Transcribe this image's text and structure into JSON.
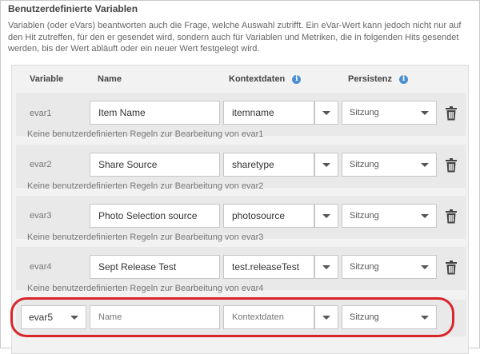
{
  "section": {
    "title": "Benutzerdefinierte Variablen",
    "description": "Variablen (oder eVars) beantworten auch die Frage, welche Auswahl zutrifft. Ein eVar-Wert kann jedoch nicht nur auf den Hit zutreffen, für den er gesendet wird, sondern auch für Variablen und Metriken, die in folgenden Hits gesendet werden, bis der Wert abläuft oder ein neuer Wert festgelegt wird."
  },
  "headers": {
    "variable": "Variable",
    "name": "Name",
    "context": "Kontextdaten",
    "persistence": "Persistenz",
    "info_glyph": "i"
  },
  "rows": [
    {
      "var": "evar1",
      "name": "Item Name",
      "context": "itemname",
      "persistence": "Sitzung",
      "note": "Keine benutzerdefinierten Regeln zur Bearbeitung von evar1"
    },
    {
      "var": "evar2",
      "name": "Share Source",
      "context": "sharetype",
      "persistence": "Sitzung",
      "note": "Keine benutzerdefinierten Regeln zur Bearbeitung von evar2"
    },
    {
      "var": "evar3",
      "name": "Photo Selection source",
      "context": "photosource",
      "persistence": "Sitzung",
      "note": "Keine benutzerdefinierten Regeln zur Bearbeitung von evar3"
    },
    {
      "var": "evar4",
      "name": "Sept Release Test",
      "context": "test.releaseTest",
      "persistence": "Sitzung",
      "note": "Keine benutzerdefinierten Regeln zur Bearbeitung von evar4"
    }
  ],
  "new_row": {
    "var": "evar5",
    "name_placeholder": "Name",
    "context_placeholder": "Kontextdaten",
    "persistence": "Sitzung"
  },
  "colors": {
    "highlight": "#d9252a",
    "info": "#4d8fd1"
  }
}
